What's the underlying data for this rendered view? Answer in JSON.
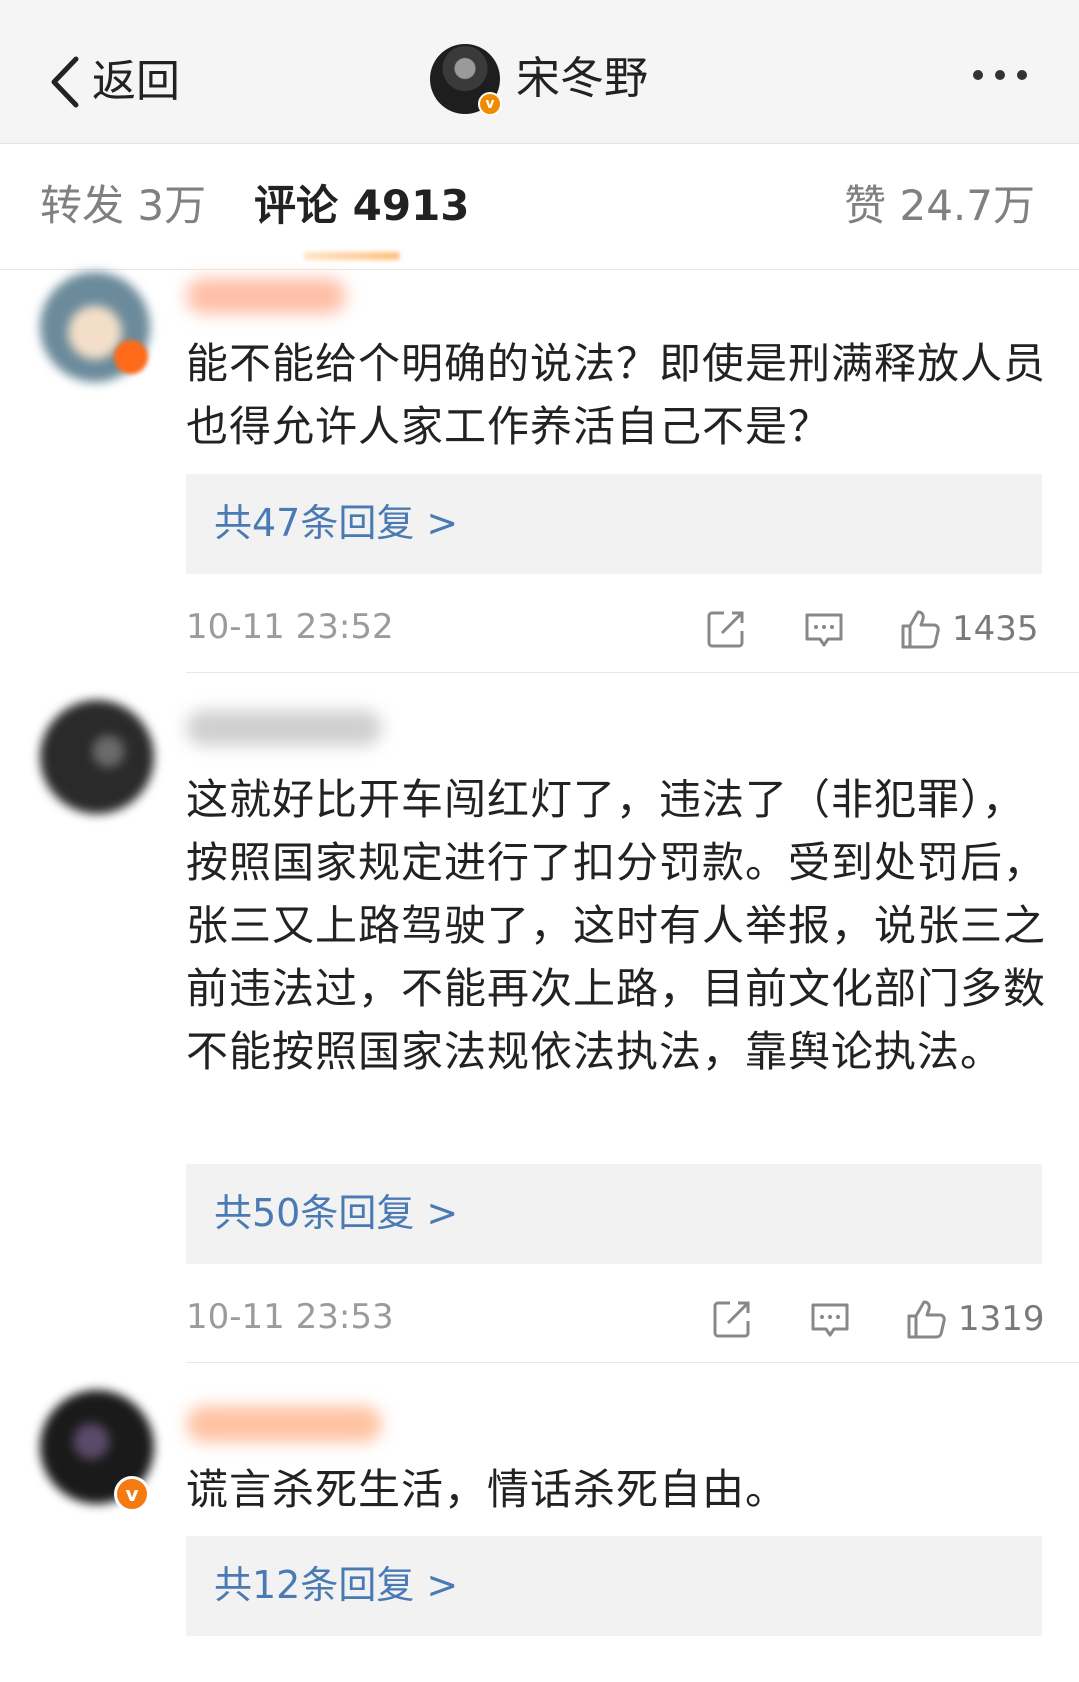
{
  "nav": {
    "back_label": "返回",
    "title": "宋冬野",
    "verified_badge": "v"
  },
  "tabs": {
    "repost": "转发 3万",
    "comment": "评论 4913",
    "like": "赞 24.7万"
  },
  "comments": [
    {
      "text": "能不能给个明确的说法？即使是刑满释放人员也得允许人家工作养活自己不是？",
      "replies": "共47条回复 >",
      "time": "10-11 23:52",
      "likes": "1435"
    },
    {
      "text": "这就好比开车闯红灯了，违法了（非犯罪），按照国家规定进行了扣分罚款。受到处罚后，张三又上路驾驶了，这时有人举报，说张三之前违法过，不能再次上路，目前文化部门多数不能按照国家法规依法执法，靠舆论执法。",
      "replies": "共50条回复 >",
      "time": "10-11 23:53",
      "likes": "1319"
    },
    {
      "text": "谎言杀死生活，情话杀死自由。",
      "replies": "共12条回复 >",
      "verified_badge": "v"
    }
  ],
  "colors": {
    "link_blue": "#4a7ab4",
    "verified_orange": "#f08a00",
    "muted_gray": "#9b9b9b"
  },
  "icons": [
    "back-chevron-icon",
    "more-icon",
    "repost-icon",
    "reply-icon",
    "like-icon"
  ]
}
